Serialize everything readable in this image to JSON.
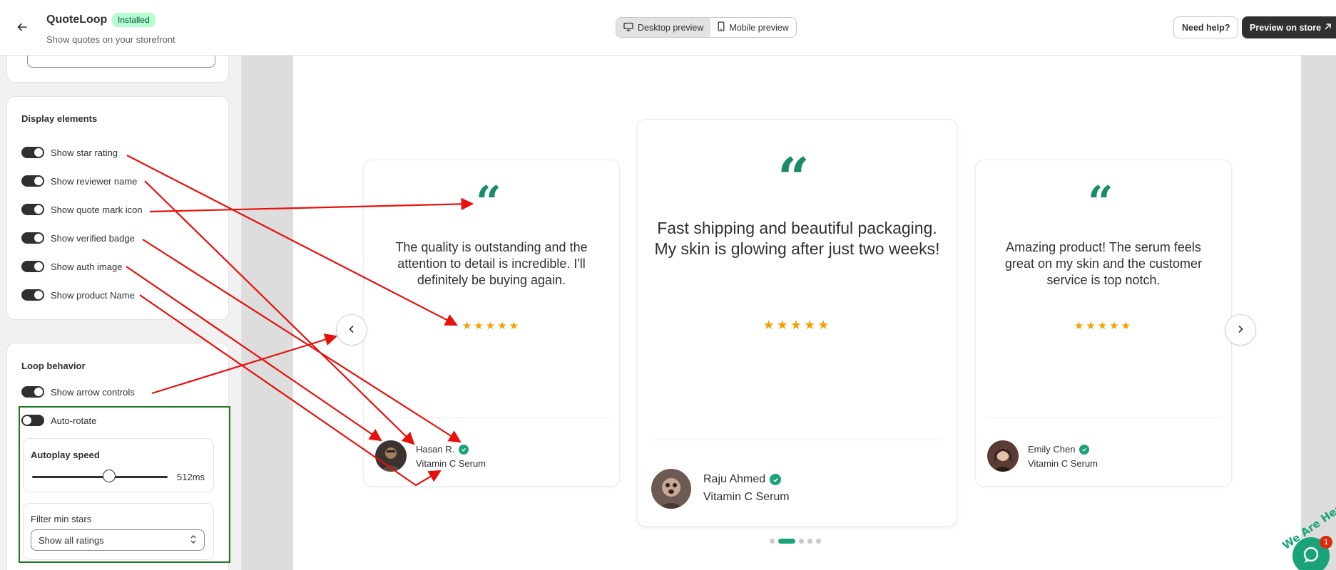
{
  "app": {
    "name": "QuoteLoop",
    "status_badge": "Installed",
    "subtitle": "Show quotes on your storefront"
  },
  "display_elements": {
    "title": "Display elements",
    "toggles": [
      {
        "label": "Show star rating",
        "on": true
      },
      {
        "label": "Show reviewer name",
        "on": true
      },
      {
        "label": "Show quote mark icon",
        "on": true
      },
      {
        "label": "Show verified badge",
        "on": true
      },
      {
        "label": "Show auth image",
        "on": true
      },
      {
        "label": "Show product Name",
        "on": true
      }
    ]
  },
  "loop_behavior": {
    "title": "Loop behavior",
    "show_arrow_controls": {
      "label": "Show arrow controls",
      "on": true
    },
    "auto_rotate": {
      "label": "Auto-rotate",
      "on": false
    },
    "autoplay_speed": {
      "label": "Autoplay speed",
      "value": "512ms",
      "fraction": 0.47
    },
    "filter_min_stars": {
      "label": "Filter min stars",
      "selected": "Show all ratings"
    }
  },
  "toolbar": {
    "desktop_preview": "Desktop preview",
    "mobile_preview": "Mobile preview",
    "active_view": "desktop",
    "need_help": "Need help?",
    "preview_on_store": "Preview on store"
  },
  "reviews": [
    {
      "text": "The quality is outstanding and the attention to detail is incredible. I'll definitely be buying again.",
      "stars": 5,
      "reviewer": "Hasan R.",
      "product": "Vitamin C Serum",
      "verified": true
    },
    {
      "text": "Fast shipping and beautiful packaging. My skin is glowing after just two weeks!",
      "stars": 5,
      "reviewer": "Raju Ahmed",
      "product": "Vitamin C Serum",
      "verified": true
    },
    {
      "text": "Amazing product! The serum feels great on my skin and the customer service is top notch.",
      "stars": 5,
      "reviewer": "Emily Chen",
      "product": "Vitamin C Serum",
      "verified": true
    }
  ],
  "carousel": {
    "dot_count": 5,
    "active_dot": 1
  },
  "chat_widget": {
    "tagline": "We Are Here",
    "unread": "1"
  },
  "colors": {
    "accent_green": "#1a8a6b",
    "star": "#f5a000",
    "annotation_arrow": "#e8100b",
    "highlight_box": "#1d7a22",
    "badge_bg": "#b4fed2"
  }
}
